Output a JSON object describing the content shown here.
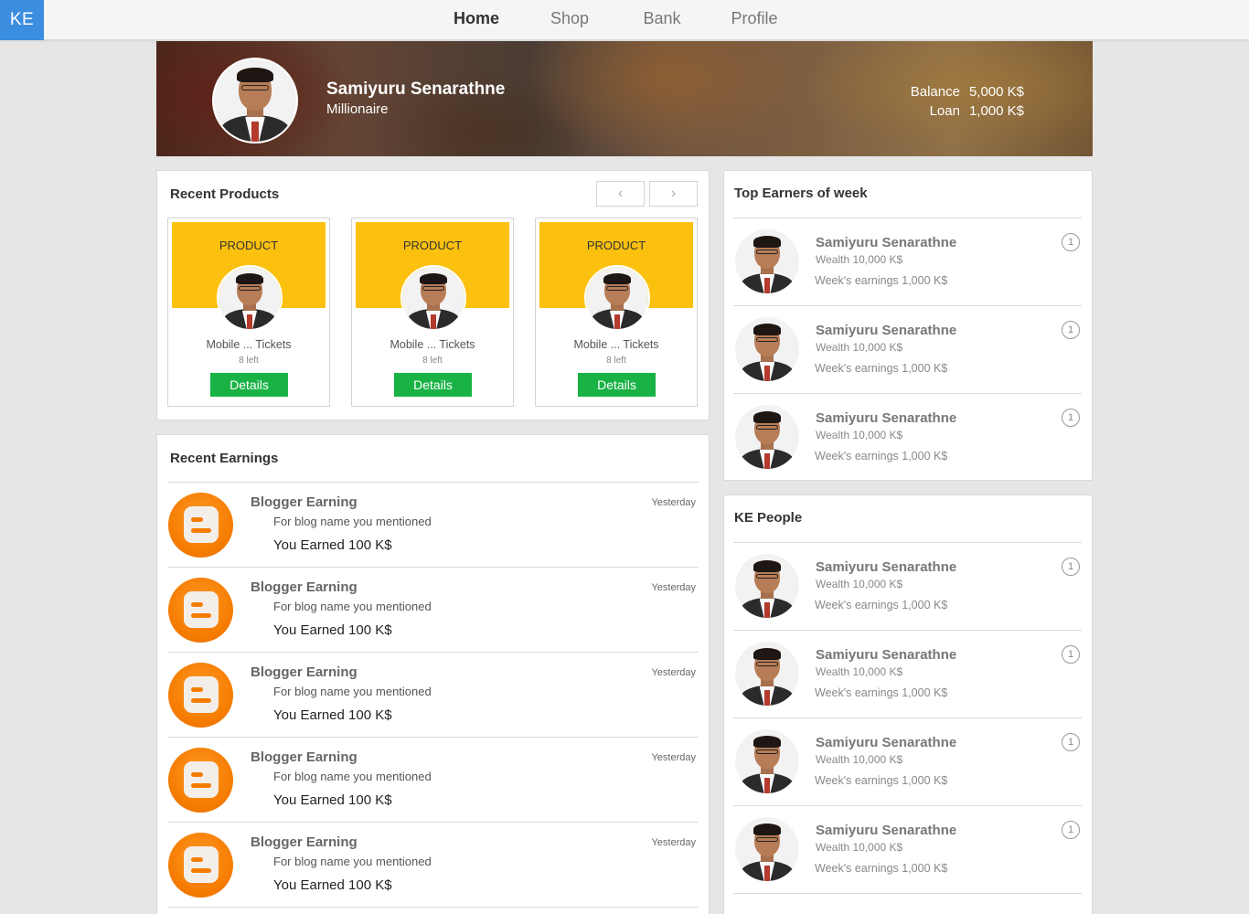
{
  "logo": "KE",
  "nav": [
    {
      "label": "Home",
      "active": true
    },
    {
      "label": "Shop",
      "active": false
    },
    {
      "label": "Bank",
      "active": false
    },
    {
      "label": "Profile",
      "active": false
    }
  ],
  "profile": {
    "name": "Samiyuru Senarathne",
    "title": "Millionaire",
    "balance_label": "Balance",
    "balance_value": "5,000 K$",
    "loan_label": "Loan",
    "loan_value": "1,000 K$"
  },
  "recent_products": {
    "title": "Recent Products",
    "prev_icon": "‹",
    "next_icon": "›",
    "items": [
      {
        "tag": "PRODUCT",
        "name": "Mobile ... Tickets",
        "left": "8 left",
        "button": "Details"
      },
      {
        "tag": "PRODUCT",
        "name": "Mobile ... Tickets",
        "left": "8 left",
        "button": "Details"
      },
      {
        "tag": "PRODUCT",
        "name": "Mobile ... Tickets",
        "left": "8 left",
        "button": "Details"
      }
    ]
  },
  "recent_earnings": {
    "title": "Recent Earnings",
    "items": [
      {
        "title": "Blogger Earning",
        "desc": "For blog name  you mentioned",
        "amount": "You Earned 100 K$",
        "time": "Yesterday"
      },
      {
        "title": "Blogger Earning",
        "desc": "For blog name  you mentioned",
        "amount": "You Earned 100 K$",
        "time": "Yesterday"
      },
      {
        "title": "Blogger Earning",
        "desc": "For blog name  you mentioned",
        "amount": "You Earned 100 K$",
        "time": "Yesterday"
      },
      {
        "title": "Blogger Earning",
        "desc": "For blog name  you mentioned",
        "amount": "You Earned 100 K$",
        "time": "Yesterday"
      },
      {
        "title": "Blogger Earning",
        "desc": "For blog name  you mentioned",
        "amount": "You Earned 100 K$",
        "time": "Yesterday"
      }
    ]
  },
  "top_earners": {
    "title": "Top Earners of week",
    "items": [
      {
        "name": "Samiyuru Senarathne",
        "wealth": "Wealth 10,000 K$",
        "earnings": "Week's earnings 1,000 K$",
        "rank": "1"
      },
      {
        "name": "Samiyuru Senarathne",
        "wealth": "Wealth 10,000 K$",
        "earnings": "Week's earnings 1,000 K$",
        "rank": "1"
      },
      {
        "name": "Samiyuru Senarathne",
        "wealth": "Wealth 10,000 K$",
        "earnings": "Week's earnings 1,000 K$",
        "rank": "1"
      }
    ]
  },
  "ke_people": {
    "title": "KE People",
    "items": [
      {
        "name": "Samiyuru Senarathne",
        "wealth": "Wealth 10,000 K$",
        "earnings": "Week's earnings 1,000 K$",
        "rank": "1"
      },
      {
        "name": "Samiyuru Senarathne",
        "wealth": "Wealth 10,000 K$",
        "earnings": "Week's earnings 1,000 K$",
        "rank": "1"
      },
      {
        "name": "Samiyuru Senarathne",
        "wealth": "Wealth 10,000 K$",
        "earnings": "Week's earnings 1,000 K$",
        "rank": "1"
      },
      {
        "name": "Samiyuru Senarathne",
        "wealth": "Wealth 10,000 K$",
        "earnings": "Week's earnings 1,000 K$",
        "rank": "1"
      }
    ]
  },
  "colors": {
    "logo_bg": "#3b8de0",
    "product_banner": "#fcc10f",
    "details_button": "#19b244",
    "blogger_orange": "#f57c00"
  }
}
